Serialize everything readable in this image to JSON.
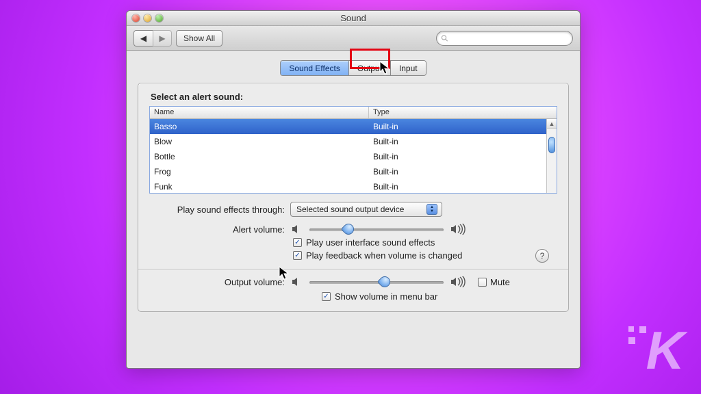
{
  "window": {
    "title": "Sound"
  },
  "toolbar": {
    "show_all": "Show All",
    "search_placeholder": ""
  },
  "tabs": {
    "sound_effects": "Sound Effects",
    "output": "Output",
    "input": "Input",
    "selected": "sound_effects",
    "highlighted": "output"
  },
  "alert_section": {
    "label": "Select an alert sound:",
    "col_name": "Name",
    "col_type": "Type",
    "rows": [
      {
        "name": "Basso",
        "type": "Built-in",
        "selected": true
      },
      {
        "name": "Blow",
        "type": "Built-in",
        "selected": false
      },
      {
        "name": "Bottle",
        "type": "Built-in",
        "selected": false
      },
      {
        "name": "Frog",
        "type": "Built-in",
        "selected": false
      },
      {
        "name": "Funk",
        "type": "Built-in",
        "selected": false
      }
    ]
  },
  "effects_through": {
    "label": "Play sound effects through:",
    "value": "Selected sound output device"
  },
  "alert_volume": {
    "label": "Alert volume:",
    "percent": 27
  },
  "checks": {
    "ui_sounds": {
      "label": "Play user interface sound effects",
      "checked": true
    },
    "feedback": {
      "label": "Play feedback when volume is changed",
      "checked": true
    }
  },
  "output_volume": {
    "label": "Output volume:",
    "percent": 55,
    "mute_label": "Mute",
    "mute_checked": false
  },
  "show_in_menu": {
    "label": "Show volume in menu bar",
    "checked": true
  },
  "help_tooltip": "?",
  "icons": {
    "speaker_low": "speaker-low",
    "speaker_high": "speaker-high",
    "search": "magnifier"
  }
}
